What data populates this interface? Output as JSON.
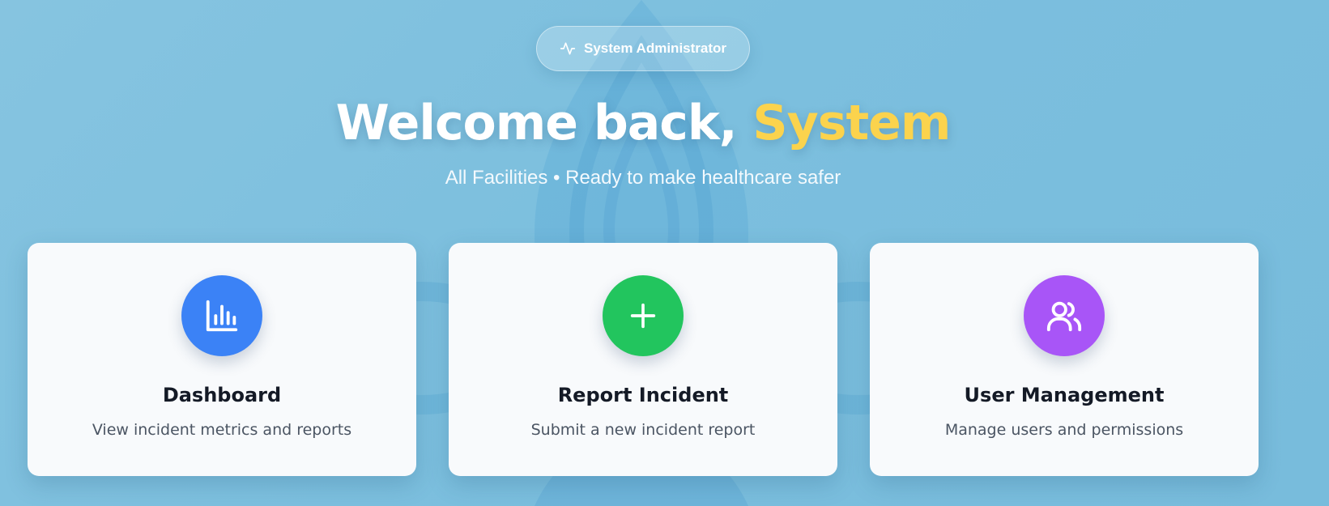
{
  "header": {
    "role_badge": {
      "label": "System Administrator",
      "icon": "activity-icon"
    },
    "welcome_prefix": "Welcome back, ",
    "welcome_name": "System",
    "subtitle": "All Facilities • Ready to make healthcare safer"
  },
  "cards": [
    {
      "title": "Dashboard",
      "description": "View incident metrics and reports",
      "icon": "bar-chart-icon",
      "icon_color": "#3b82f6"
    },
    {
      "title": "Report Incident",
      "description": "Submit a new incident report",
      "icon": "plus-icon",
      "icon_color": "#22c55e"
    },
    {
      "title": "User Management",
      "description": "Manage users and permissions",
      "icon": "users-icon",
      "icon_color": "#a855f7"
    }
  ],
  "colors": {
    "background": "#7cbfde",
    "highlight_name": "#fbd34d",
    "card_background": "#f8fafc"
  }
}
